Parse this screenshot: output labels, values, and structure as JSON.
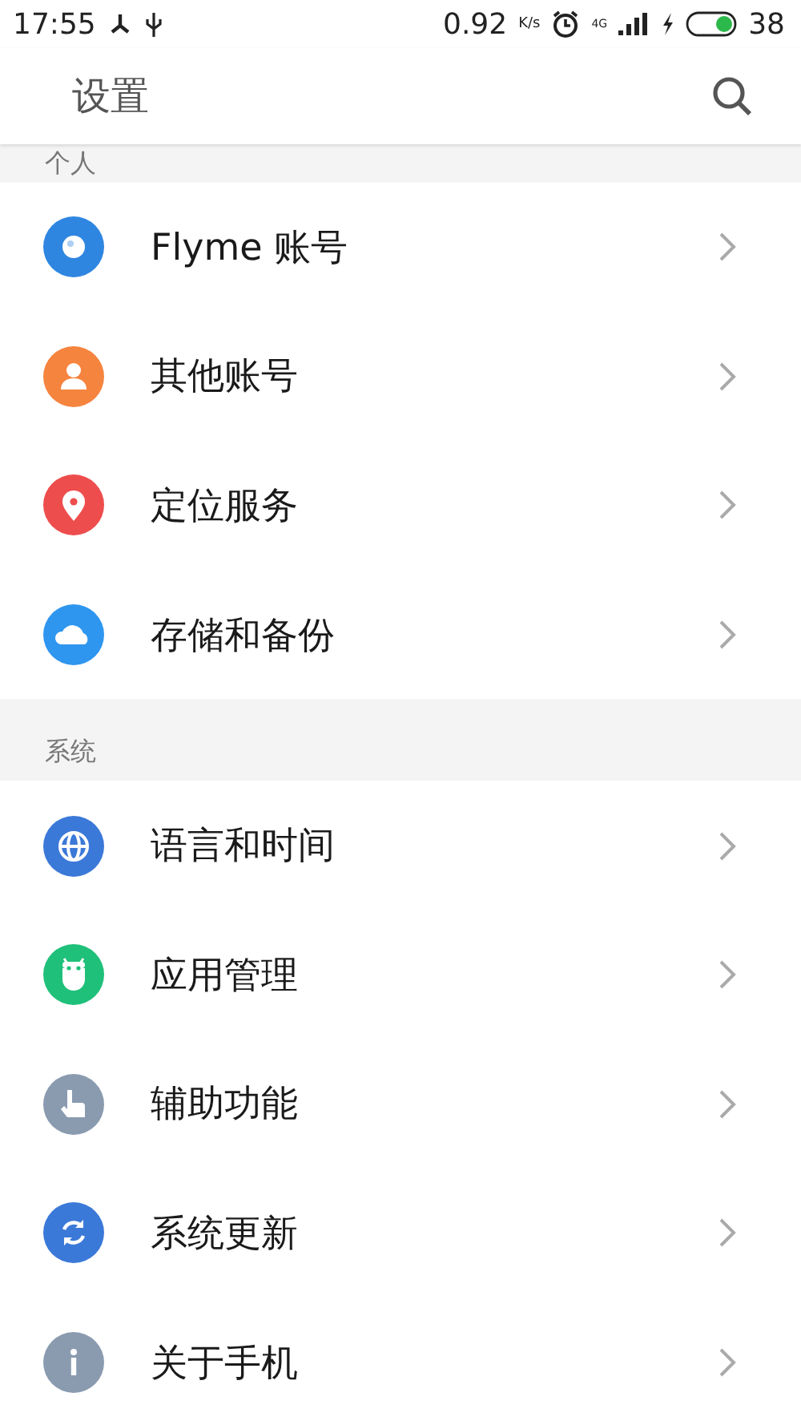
{
  "status_bar": {
    "time": "17:55",
    "speed": "0.92",
    "speed_unit": "K/s",
    "network": "4G",
    "battery": "38"
  },
  "header": {
    "title": "设置"
  },
  "sections": [
    {
      "title": "个人",
      "items": [
        {
          "label": "Flyme 账号"
        },
        {
          "label": "其他账号"
        },
        {
          "label": "定位服务"
        },
        {
          "label": "存储和备份"
        }
      ]
    },
    {
      "title": "系统",
      "items": [
        {
          "label": "语言和时间"
        },
        {
          "label": "应用管理"
        },
        {
          "label": "辅助功能"
        },
        {
          "label": "系统更新"
        },
        {
          "label": "关于手机"
        }
      ]
    }
  ]
}
